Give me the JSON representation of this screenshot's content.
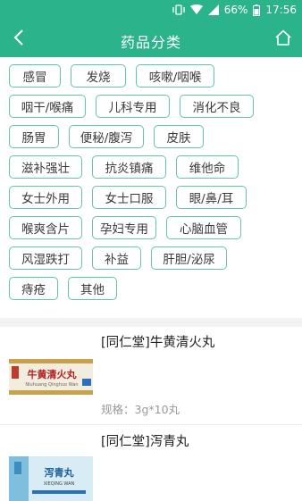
{
  "status_bar": {
    "battery": "66%",
    "time": "17:56"
  },
  "nav": {
    "title": "药品分类",
    "back_icon": "chevron-left-icon",
    "home_icon": "home-icon"
  },
  "colors": {
    "brand": "#2bb38c",
    "chip_border": "#64c6a6"
  },
  "categories": [
    "感冒",
    "发烧",
    "咳嗽/咽喉",
    "咽干/喉痛",
    "儿科专用",
    "消化不良",
    "肠胃",
    "便秘/腹泻",
    "皮肤",
    "滋补强壮",
    "抗炎镇痛",
    "维他命",
    "女士外用",
    "女士口服",
    "眼/鼻/耳",
    "喉爽含片",
    "孕妇专用",
    "心脑血管",
    "风湿跌打",
    "补益",
    "肝胆/泌尿",
    "痔疮",
    "其他"
  ],
  "products": [
    {
      "name": "[同仁堂]牛黄清火丸",
      "spec": "规格：3g*10丸",
      "package_text": "牛黄清火丸",
      "package_sub": "Niuhuang Qinghuo Wan"
    },
    {
      "name": "[同仁堂]泻青丸",
      "spec": "",
      "package_text": "泻青丸",
      "package_sub": "XIEQING WAN"
    }
  ]
}
